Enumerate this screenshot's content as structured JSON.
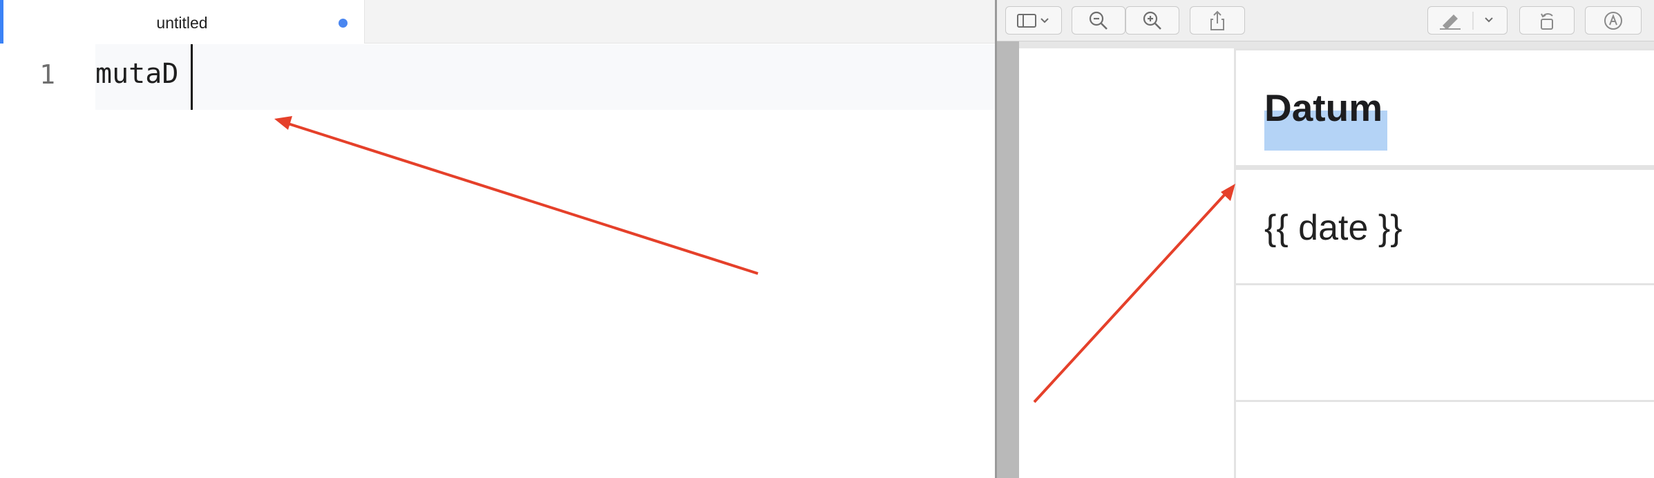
{
  "editor": {
    "tab": {
      "title": "untitled",
      "modified_indicator": "unsaved-dot"
    },
    "lines": [
      {
        "number": "1",
        "text": "mutaD"
      }
    ]
  },
  "preview": {
    "toolbar": {
      "buttons": [
        {
          "icon": "sidebar-toggle-icon",
          "has_dropdown": true
        },
        {
          "icon": "zoom-out-icon"
        },
        {
          "icon": "zoom-in-icon"
        },
        {
          "icon": "share-icon"
        },
        {
          "icon": "highlight-pen-icon",
          "has_dropdown": true
        },
        {
          "icon": "rotate-icon"
        },
        {
          "icon": "markup-icon"
        }
      ]
    },
    "table": {
      "header": "Datum",
      "cell": "{{ date }}"
    }
  },
  "annotations": {
    "arrow_color": "#e5402a",
    "accent_color": "#3b82f6",
    "selection_color": "#b4d3f6"
  }
}
